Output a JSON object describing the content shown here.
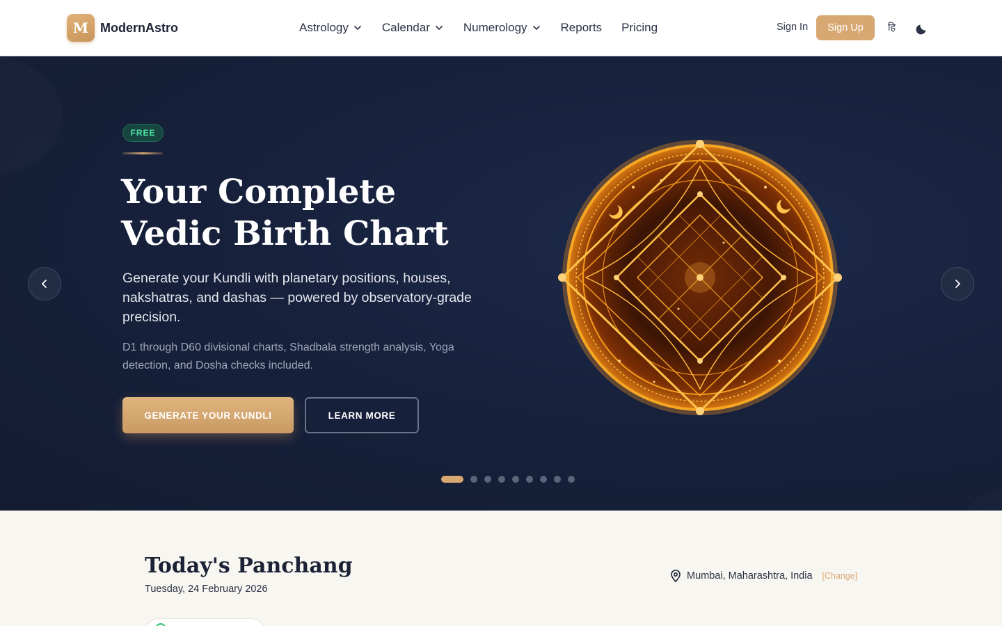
{
  "brand": {
    "mark": "M",
    "name": "ModernAstro",
    "accent": "#d8a872"
  },
  "nav": {
    "items": [
      {
        "label": "Astrology",
        "dropdown": true
      },
      {
        "label": "Calendar",
        "dropdown": true
      },
      {
        "label": "Numerology",
        "dropdown": true
      },
      {
        "label": "Reports",
        "dropdown": false
      },
      {
        "label": "Pricing",
        "dropdown": false
      }
    ],
    "sign_in": "Sign In",
    "sign_up": "Sign Up",
    "language": "हि",
    "theme_icon": "moon-icon"
  },
  "hero": {
    "badge": "FREE",
    "title_line1": "Your Complete",
    "title_line2": "Vedic Birth Chart",
    "subtitle": "Generate your Kundli with planetary positions, houses, nakshatras, and dashas — powered by observatory-grade precision.",
    "detail": "D1 through D60 divisional charts, Shadbala strength analysis, Yoga detection, and Dosha checks included.",
    "primary_cta": "GENERATE YOUR KUNDLI",
    "secondary_cta": "LEARN MORE",
    "slides_total": 9,
    "active_slide": 1,
    "prev_icon": "chevron-left-icon",
    "next_icon": "chevron-right-icon",
    "image": "golden-vedic-chart-mandala"
  },
  "panchang": {
    "title": "Today's Panchang",
    "date": "Tuesday, 24 February 2026",
    "location": "Mumbai, Maharashtra, India",
    "change_label": "[Change]",
    "location_icon": "map-pin-icon"
  },
  "colors": {
    "hero_bg": "#17213c",
    "badge_text": "#4ee2a7",
    "primary_button": "#d8a872"
  }
}
